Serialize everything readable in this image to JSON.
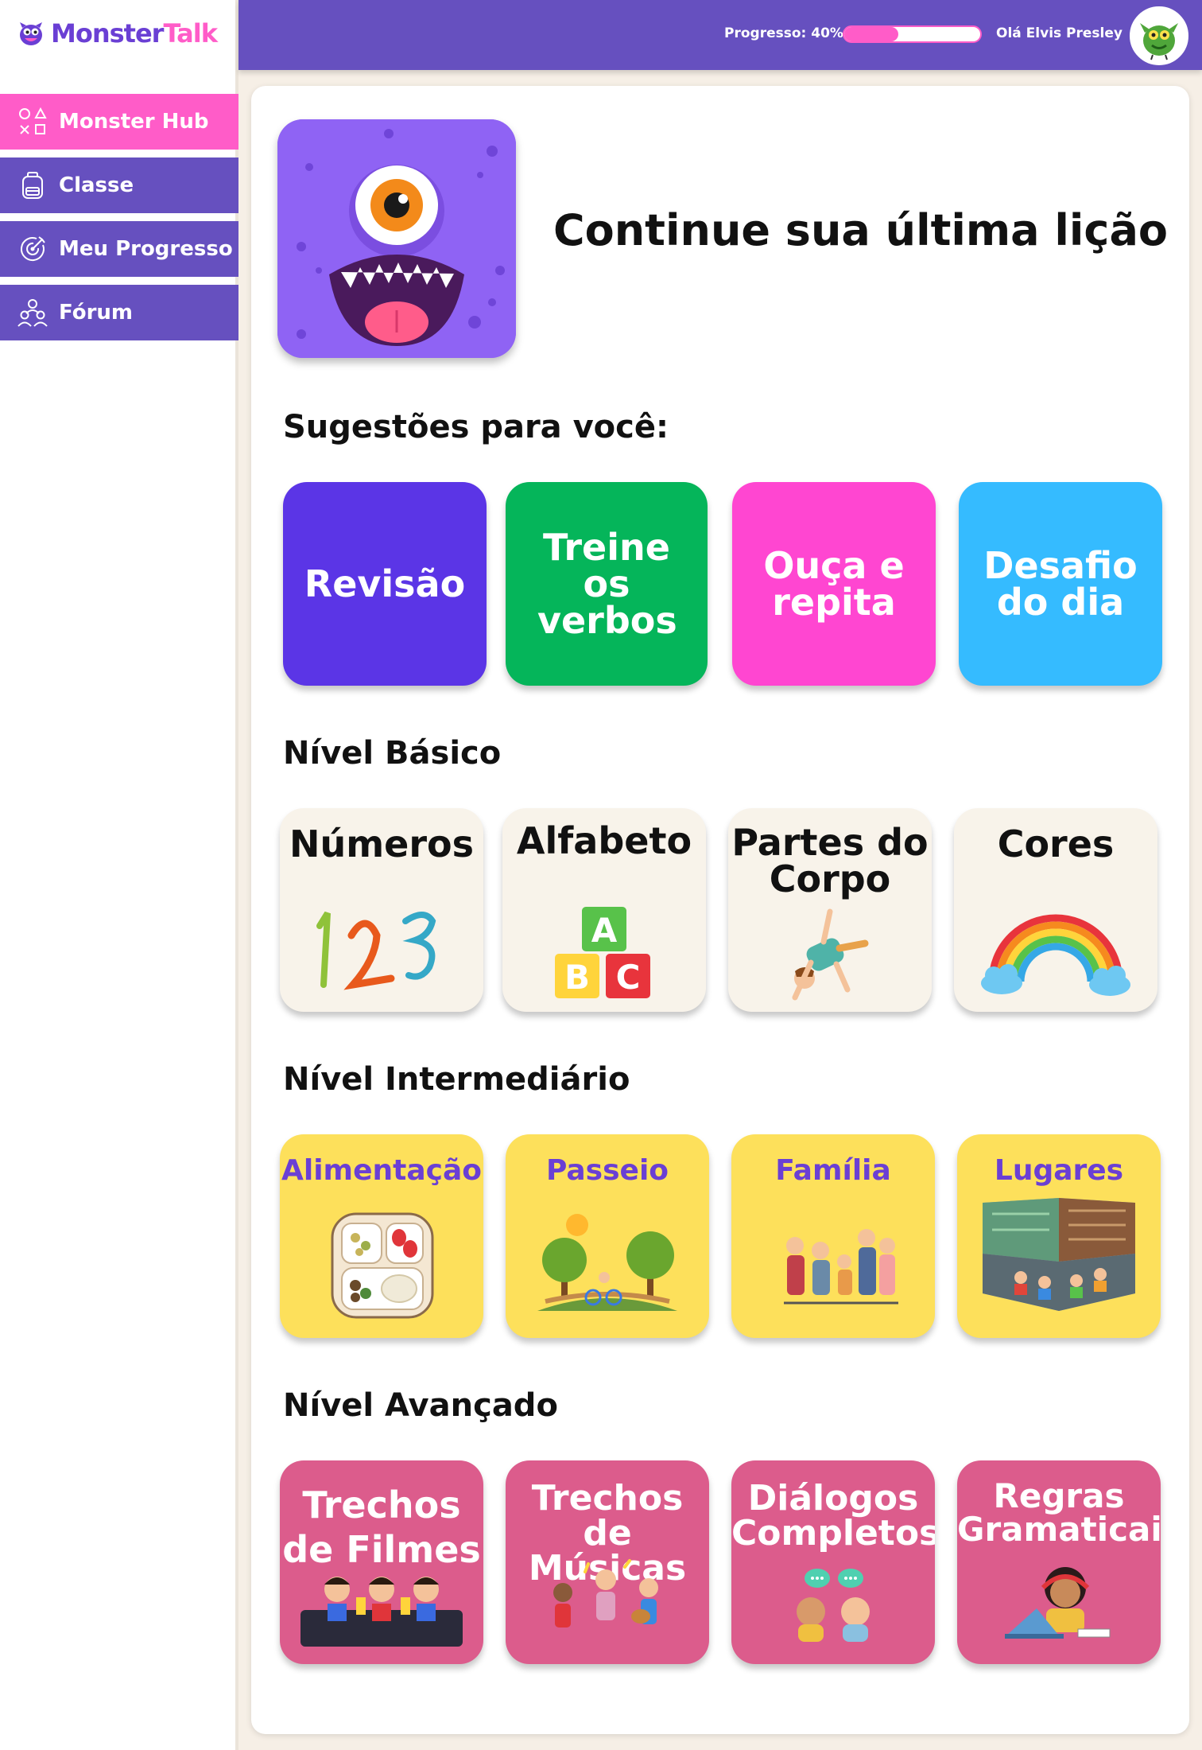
{
  "brand": {
    "part1": "Monster",
    "part2": "Talk"
  },
  "sidebar": {
    "items": [
      {
        "label": "Monster Hub",
        "icon": "shapes-icon",
        "active": true
      },
      {
        "label": "Classe",
        "icon": "backpack-icon",
        "active": false
      },
      {
        "label": "Meu Progresso",
        "icon": "target-icon",
        "active": false
      },
      {
        "label": "Fórum",
        "icon": "people-icon",
        "active": false
      }
    ]
  },
  "header": {
    "progress_label": "Progresso: 40%",
    "progress_value": 0.4,
    "greeting": "Olá Elvis Presley",
    "avatar": "green-monster-avatar"
  },
  "hero": {
    "title": "Continue sua última lição",
    "image": "purple-one-eyed-monster"
  },
  "suggestions": {
    "title": "Sugestões para você:",
    "cards": [
      {
        "label": "Revisão",
        "color": "#5b35e6"
      },
      {
        "label": "Treine os verbos",
        "color": "#05b55a"
      },
      {
        "label": "Ouça e repita",
        "color": "#ff46d1"
      },
      {
        "label": "Desafio do dia",
        "color": "#35bbff"
      }
    ]
  },
  "basic": {
    "title": "Nível Básico",
    "cards": [
      {
        "label": "Números",
        "art": "numbers-123"
      },
      {
        "label": "Alfabeto",
        "art": "abc-blocks"
      },
      {
        "label": "Partes do Corpo",
        "art": "cartwheel-kid"
      },
      {
        "label": "Cores",
        "art": "rainbow"
      }
    ]
  },
  "intermediate": {
    "title": "Nível Intermediário",
    "cards": [
      {
        "label": "Alimentação",
        "art": "lunch-tray"
      },
      {
        "label": "Passeio",
        "art": "park-bikes"
      },
      {
        "label": "Família",
        "art": "family-group"
      },
      {
        "label": "Lugares",
        "art": "library-room"
      }
    ]
  },
  "advanced": {
    "title": "Nível Avançado",
    "cards": [
      {
        "label": "Trechos de Filmes",
        "art": "cinema-kids"
      },
      {
        "label": "Trechos de Músicas",
        "art": "singing-kids"
      },
      {
        "label": "Diálogos Completos",
        "art": "chat-kids"
      },
      {
        "label": "Regras Gramaticais",
        "art": "laptop-girl"
      }
    ]
  }
}
